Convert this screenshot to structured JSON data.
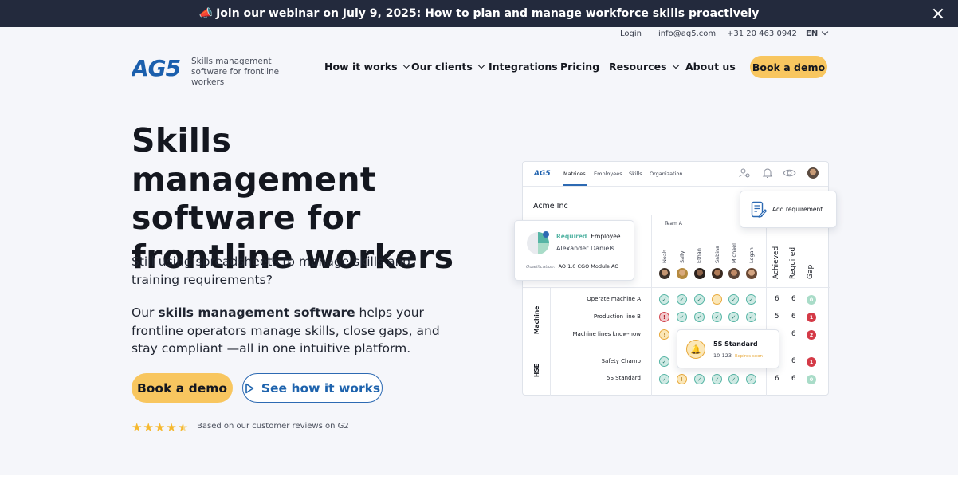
{
  "announcement": {
    "text": "Join our webinar on July 9, 2025: How to plan and manage workforce skills proactively"
  },
  "utility": {
    "login": "Login",
    "email": "info@ag5.com",
    "phone": "+31 20 463 0942",
    "language": "EN"
  },
  "header": {
    "logo_text": "AG5",
    "tagline": "Skills management software for frontline workers",
    "nav": [
      {
        "label": "How it works",
        "dropdown": true
      },
      {
        "label": "Our clients",
        "dropdown": true
      },
      {
        "label": "Integrations",
        "dropdown": false
      },
      {
        "label": "Pricing",
        "dropdown": false
      },
      {
        "label": "Resources",
        "dropdown": true
      },
      {
        "label": "About us",
        "dropdown": false
      }
    ],
    "cta": "Book a demo"
  },
  "hero": {
    "title": "Skills management software for frontline workers",
    "paragraph1": "Still using spreadsheets to manage skills and training requirements?",
    "p2_before": "Our ",
    "p2_bold": "skills management software",
    "p2_after": " helps your frontline operators manage skills, close gaps, and stay compliant —all in one intuitive platform.",
    "primary_button": "Book a demo",
    "secondary_button": "See how it works",
    "rating_stars": 4.5,
    "rating_text": "Based on our customer reviews on G2"
  },
  "mockup": {
    "logo": "AG5",
    "tabs": [
      "Matrices",
      "Employees",
      "Skills",
      "Organization"
    ],
    "company": "Acme Inc",
    "team": "Team A",
    "employees": [
      "Noah",
      "Sally",
      "Ethan",
      "Sabina",
      "Michael",
      "Logan"
    ],
    "summary_headers": [
      "Achieved",
      "Required",
      "Gap"
    ],
    "groups": [
      {
        "name": "Machine",
        "rows": [
          {
            "label": "Operate machine A",
            "cells": [
              "ok",
              "ok",
              "ok",
              "warn",
              "ok",
              "ok"
            ],
            "achieved": "6",
            "required": "6",
            "gap": "0",
            "gap_status": "ok"
          },
          {
            "label": "Production line B",
            "cells": [
              "err",
              "ok",
              "ok",
              "ok",
              "ok",
              "ok"
            ],
            "achieved": "5",
            "required": "6",
            "gap": "1",
            "gap_status": "bad"
          },
          {
            "label": "Machine lines know-how",
            "cells": [
              "warn",
              "",
              "",
              "",
              "",
              ""
            ],
            "achieved": "4",
            "required": "6",
            "gap": "2",
            "gap_status": "bad"
          }
        ]
      },
      {
        "name": "HSE",
        "rows": [
          {
            "label": "Safety Champ",
            "cells": [
              "ok",
              "",
              "",
              "",
              "",
              ""
            ],
            "achieved": "5",
            "required": "6",
            "gap": "1",
            "gap_status": "bad"
          },
          {
            "label": "5S Standard",
            "cells": [
              "ok",
              "warn",
              "ok",
              "ok",
              "ok",
              "ok"
            ],
            "achieved": "6",
            "required": "6",
            "gap": "0",
            "gap_status": "ok"
          }
        ]
      }
    ],
    "req_card": {
      "status": "Required",
      "role": "Employee",
      "name": "Alexander Daniels",
      "qual_label": "Qualification:",
      "qual_value": "AO 1.0 CGO Module AO"
    },
    "add_card": {
      "label": "Add requirement"
    },
    "standard_card": {
      "title": "5S Standard",
      "code": "10-123",
      "expiry": "Expires soon"
    }
  },
  "colors": {
    "accent": "#f8c65f",
    "brand": "#1b5fad",
    "announce_bg": "#232a3d",
    "ok": "#56b5a5",
    "warn": "#e8a93a",
    "err": "#d2434d"
  }
}
